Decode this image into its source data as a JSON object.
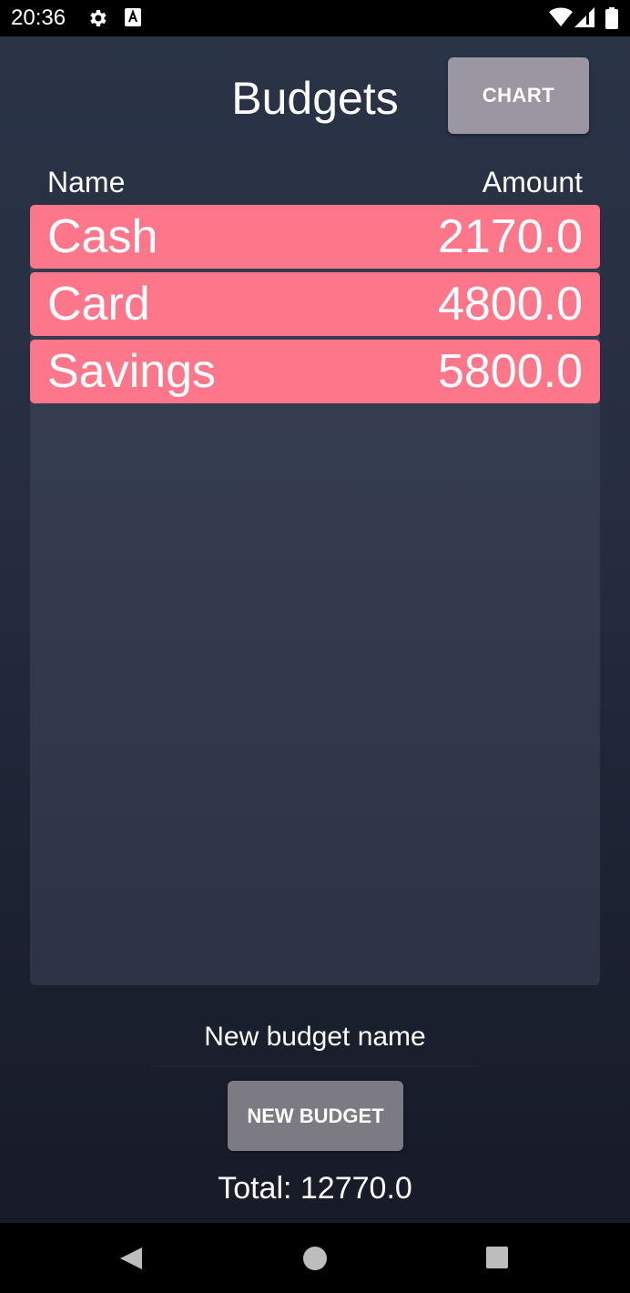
{
  "status_bar": {
    "time": "20:36",
    "icons": [
      "gear-icon",
      "keyboard-a-icon",
      "wifi-icon",
      "cell-signal-icon",
      "battery-icon"
    ]
  },
  "header": {
    "title": "Budgets",
    "chart_button_label": "CHART"
  },
  "table": {
    "columns": [
      "Name",
      "Amount"
    ],
    "rows": [
      {
        "name": "Cash",
        "amount": "2170.0"
      },
      {
        "name": "Card",
        "amount": "4800.0"
      },
      {
        "name": "Savings",
        "amount": "5800.0"
      }
    ]
  },
  "form": {
    "name_placeholder": "New budget name",
    "new_budget_label": "NEW BUDGET"
  },
  "footer": {
    "total": "Total: 12770.0"
  },
  "nav_bar": {
    "buttons": [
      "back-icon",
      "home-icon",
      "recents-icon"
    ]
  },
  "colors": {
    "row_background": "#fe7689",
    "chart_button": "#9a96a2",
    "new_budget_button": "#7c7a83",
    "app_background_top": "#2a3447",
    "app_background_bottom": "#171b28"
  }
}
